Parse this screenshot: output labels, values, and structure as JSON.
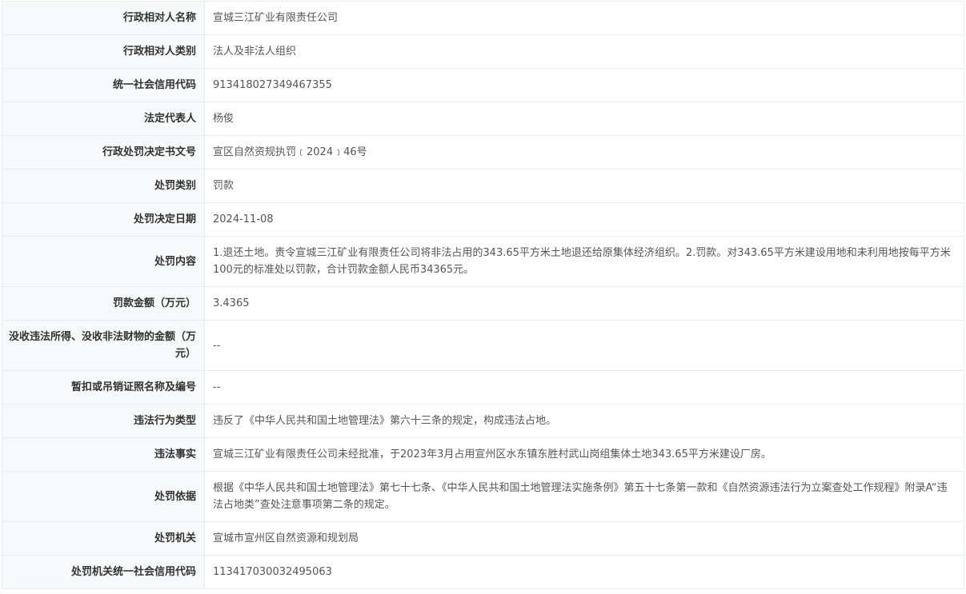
{
  "rows": [
    {
      "label": "行政相对人名称",
      "value": "宣城三江矿业有限责任公司"
    },
    {
      "label": "行政相对人类别",
      "value": "法人及非法人组织"
    },
    {
      "label": "统一社会信用代码",
      "value": "913418027349467355"
    },
    {
      "label": "法定代表人",
      "value": "杨俊"
    },
    {
      "label": "行政处罚决定书文号",
      "value": "宣区自然资规执罚﹝2024﹞46号"
    },
    {
      "label": "处罚类别",
      "value": "罚款"
    },
    {
      "label": "处罚决定日期",
      "value": "2024-11-08"
    },
    {
      "label": "处罚内容",
      "value": "1.退还土地。责令宣城三江矿业有限责任公司将非法占用的343.65平方米土地退还给原集体经济组织。2.罚款。对343.65平方米建设用地和未利用地按每平方米100元的标准处以罚款，合计罚款金额人民币34365元。"
    },
    {
      "label": "罚款金额（万元）",
      "value": "3.4365"
    },
    {
      "label": "没收违法所得、没收非法财物的金额（万元）",
      "value": "--"
    },
    {
      "label": "暂扣或吊销证照名称及编号",
      "value": "--"
    },
    {
      "label": "违法行为类型",
      "value": "违反了《中华人民共和国土地管理法》第六十三条的规定，构成违法占地。"
    },
    {
      "label": "违法事实",
      "value": "宣城三江矿业有限责任公司未经批准，于2023年3月占用宣州区水东镇东胜村武山岗组集体土地343.65平方米建设厂房。"
    },
    {
      "label": "处罚依据",
      "value": "根据《中华人民共和国土地管理法》第七十七条、《中华人民共和国土地管理法实施条例》第五十七条第一款和《自然资源违法行为立案查处工作规程》附录A“违法占地类”查处注意事项第二条的规定。"
    },
    {
      "label": "处罚机关",
      "value": "宣城市宣州区自然资源和规划局"
    },
    {
      "label": "处罚机关统一社会信用代码",
      "value": "113417030032495063"
    }
  ]
}
